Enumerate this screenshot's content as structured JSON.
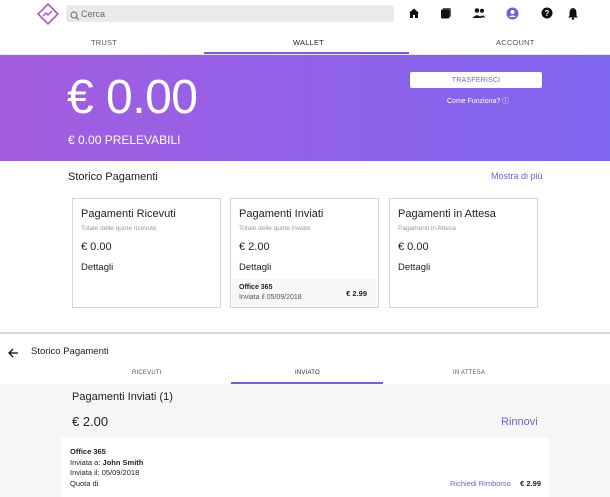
{
  "search": {
    "placeholder": "Cerca"
  },
  "top_nav": {
    "icons": [
      "home-icon",
      "cards-icon",
      "people-icon",
      "account-icon",
      "help-icon",
      "bell-icon"
    ]
  },
  "tabs": [
    {
      "label": "TRUST"
    },
    {
      "label": "WALLET"
    },
    {
      "label": "ACCOUNT"
    }
  ],
  "hero": {
    "amount": "€ 0.00",
    "withdrawable": "€ 0.00 PRELEVABILI",
    "transfer_button": "TRASFERISCI",
    "how_it_works": "Come Funziona? ⓘ"
  },
  "history": {
    "title": "Storico Pagamenti",
    "more_link": "Mostra di più",
    "cards": [
      {
        "title": "Pagamenti Ricevuti",
        "subtitle": "Totale delle quote ricevute",
        "value": "€ 0.00",
        "details": "Dettagli"
      },
      {
        "title": "Pagamenti Inviati",
        "subtitle": "Totale delle quote inviate",
        "value": "€ 2.00",
        "details": "Dettagli",
        "footer": {
          "name": "Office 365",
          "date": "Inviata il 05/09/2018",
          "amount": "€ 2.99"
        }
      },
      {
        "title": "Pagamenti in Attesa",
        "subtitle": "Pagamenti in Attesa",
        "value": "€ 0.00",
        "details": "Dettagli"
      }
    ]
  },
  "lower": {
    "title": "Storico Pagamenti",
    "subtabs": [
      {
        "label": "RICEVUTI"
      },
      {
        "label": "INVIATO"
      },
      {
        "label": "IN ATTESA"
      }
    ],
    "list_title": "Pagamenti Inviati (1)",
    "total": "€ 2.00",
    "renew": "Rinnovi",
    "payment": {
      "name": "Office 365",
      "sent_to_label": "Inviata a:",
      "sent_to_value": "John Smith",
      "sent_on_label": "Inviata il:",
      "sent_on_value": "05/09/2018",
      "share_label": "Quota di",
      "refund": "Richiedi Rimborso",
      "amount": "€ 2.99"
    }
  },
  "colors": {
    "accent": "#7b5cd6",
    "hero_start": "#a35dde",
    "hero_end": "#7f66ee"
  }
}
